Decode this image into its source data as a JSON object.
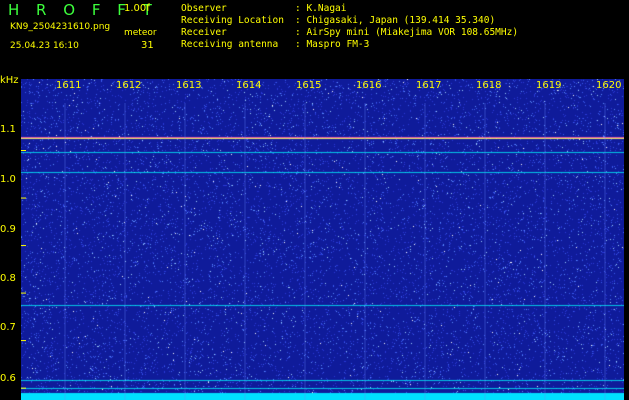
{
  "header": {
    "title": "H R O F F T",
    "version": "1.00f",
    "filename": "KN9_2504231610.png",
    "datetime": "25.04.23 16:10",
    "meteor_label": "meteor",
    "meteor_count": "31"
  },
  "info": [
    {
      "key": "Observer",
      "value": ": K.Nagai"
    },
    {
      "key": "Receiving Location",
      "value": ": Chigasaki, Japan (139.414 35.340)"
    },
    {
      "key": "Receiver",
      "value": ": AirSpy mini (Miakejima VOR 108.65MHz)"
    },
    {
      "key": "Receiving antenna",
      "value": ": Maspro FM-3"
    }
  ],
  "colors": {
    "text": "#ffff00",
    "title": "#3cff3c",
    "background": "#0f1b9a",
    "trace": "#00ffff"
  },
  "chart_data": {
    "type": "heatmap",
    "ylabel": "kHz",
    "ytick_labels": [
      "1.1",
      "1.0",
      "0.9",
      "0.8",
      "0.7",
      "0.6"
    ],
    "yticks": [
      1.1,
      1.0,
      0.9,
      0.8,
      0.7,
      0.6
    ],
    "ylim": [
      0.575,
      1.2
    ],
    "xtick_labels": [
      "1611",
      "1612",
      "1613",
      "1614",
      "1615",
      "1616",
      "1617",
      "1618",
      "1619",
      "1620"
    ],
    "xlim": [
      "1610",
      "1620"
    ],
    "persistent_lines_khz": [
      1.128,
      1.096,
      1.055,
      0.775,
      0.618,
      0.6
    ],
    "grid": true
  }
}
